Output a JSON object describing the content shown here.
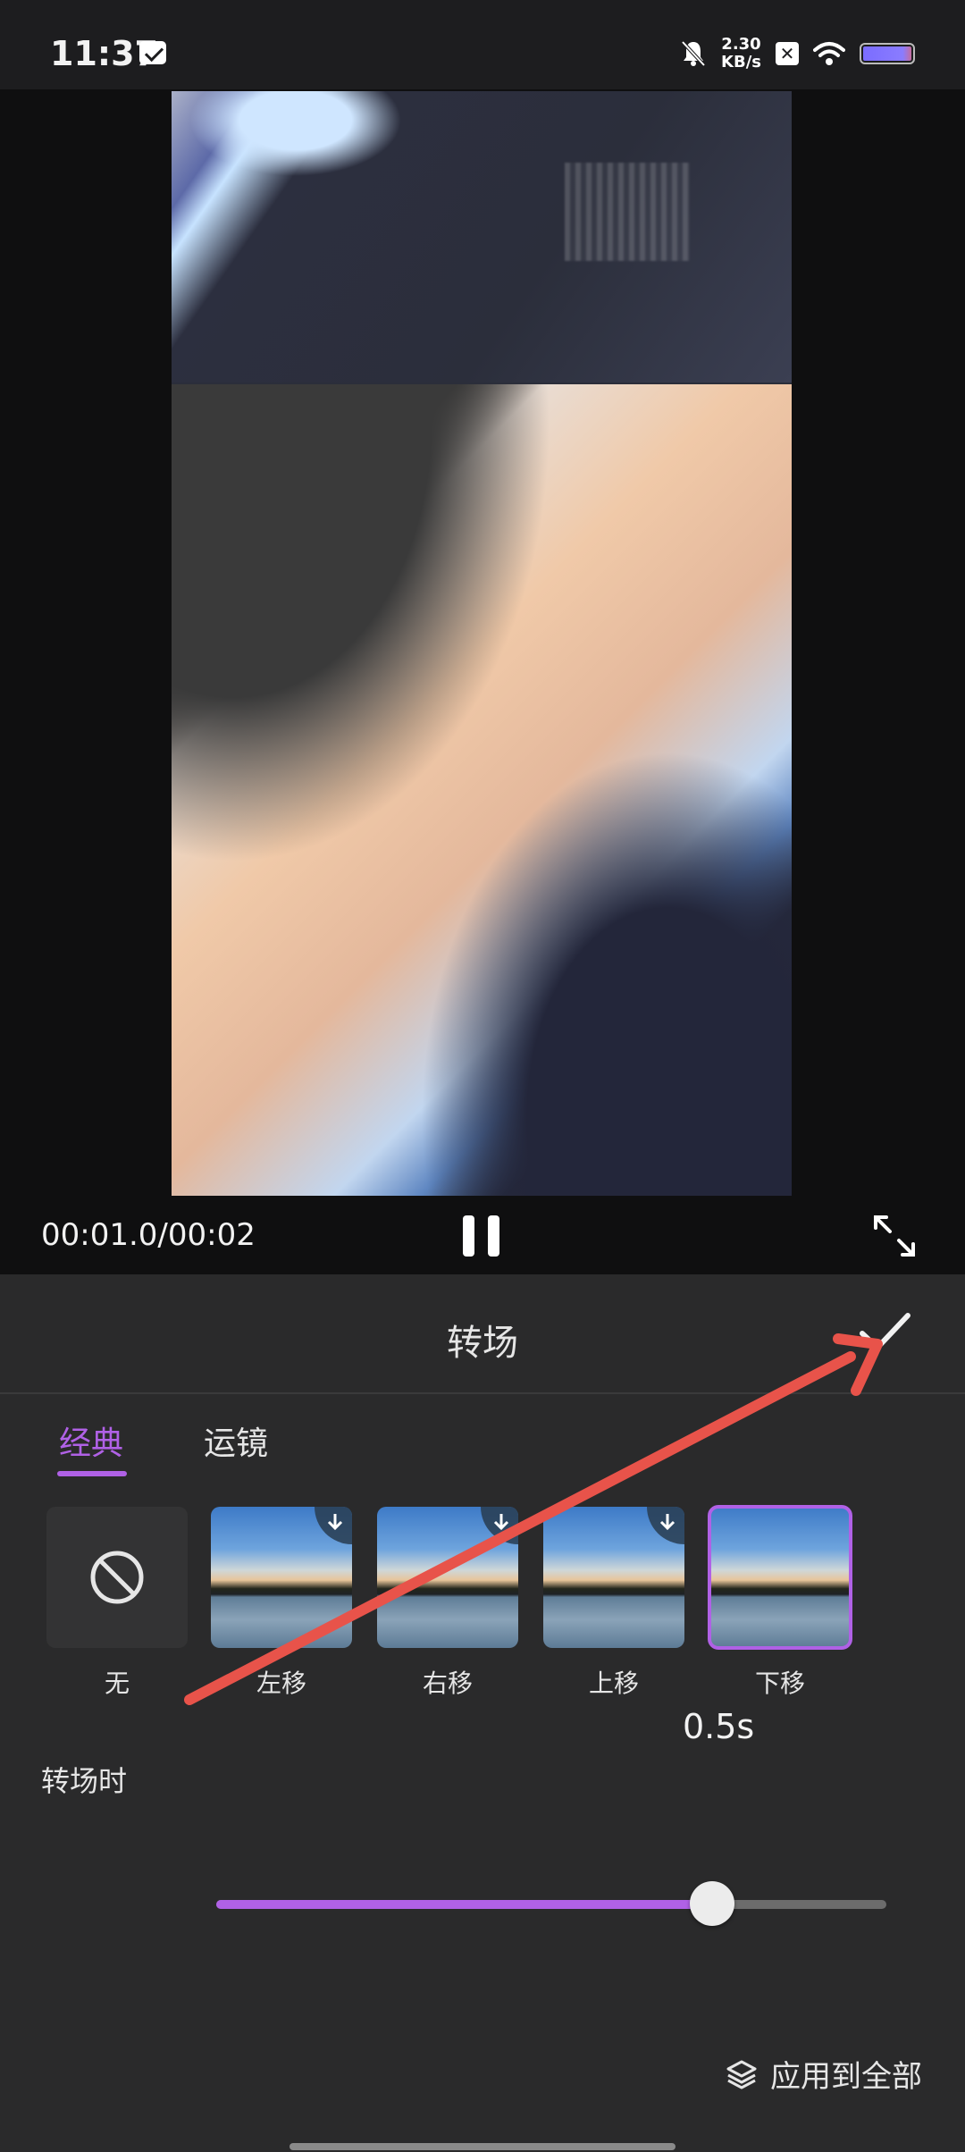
{
  "status_bar": {
    "time": "11:37",
    "net_speed_value": "2.30",
    "net_speed_unit": "KB/s",
    "x_badge": "✕"
  },
  "player": {
    "timecode": "00:01.0/00:02"
  },
  "panel": {
    "title": "转场",
    "tabs": [
      {
        "label": "经典",
        "active": true
      },
      {
        "label": "运镜",
        "active": false
      }
    ],
    "transitions": [
      {
        "label": "无",
        "icon": "ban-icon"
      },
      {
        "label": "左移",
        "download": true
      },
      {
        "label": "右移",
        "download": true
      },
      {
        "label": "上移",
        "download": true
      },
      {
        "label": "下移",
        "selected": true
      }
    ],
    "duration": {
      "label": "转场时",
      "value": "0.5s",
      "fraction": 0.74
    },
    "apply_all_label": "应用到全部"
  },
  "colors": {
    "accent": "#b061e6",
    "annotation": "#e8534a"
  }
}
